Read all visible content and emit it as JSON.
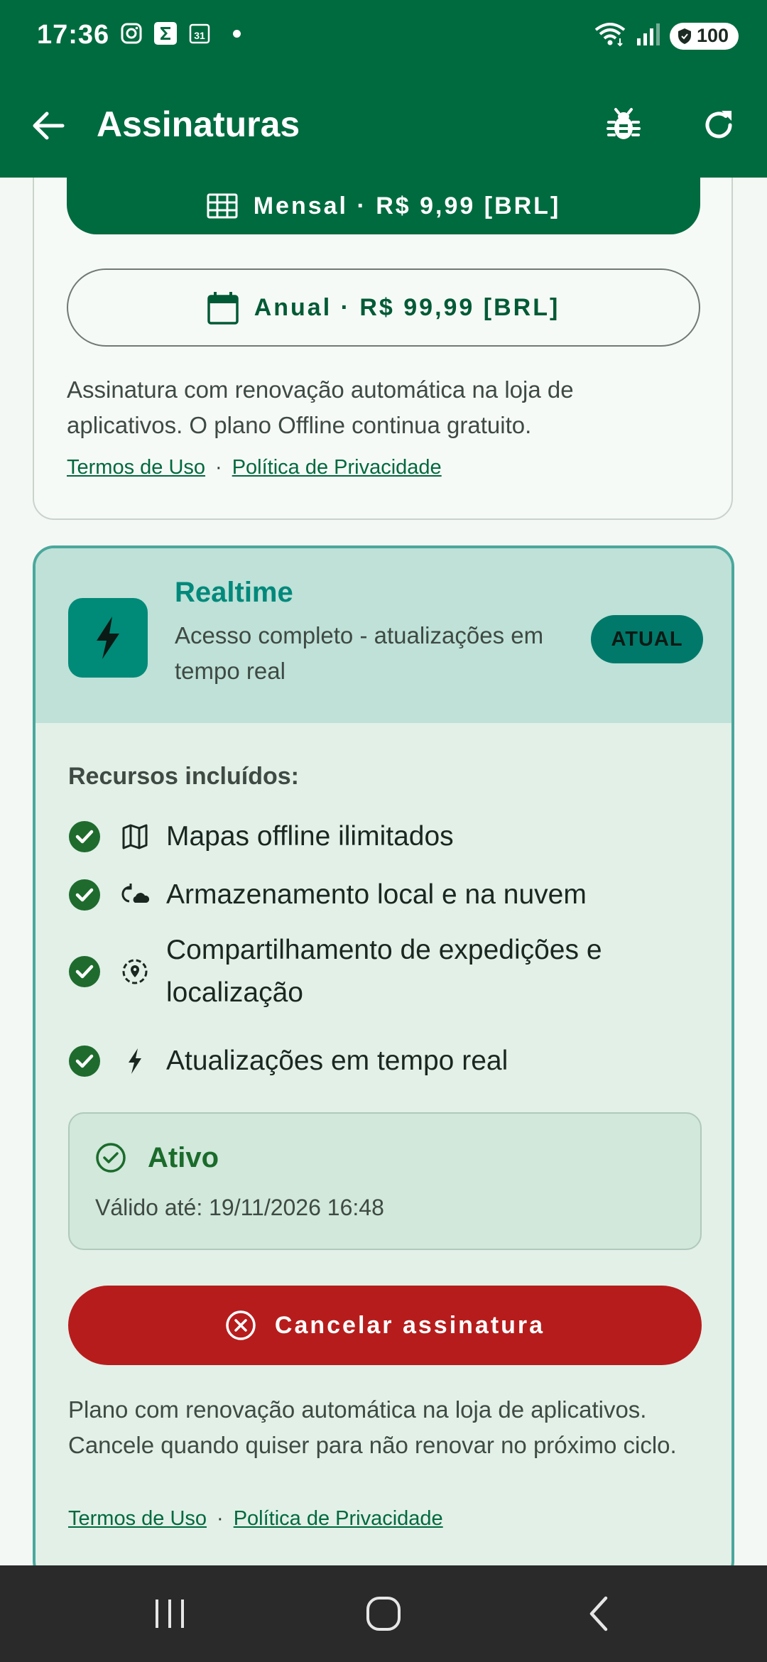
{
  "status_bar": {
    "time": "17:36",
    "icons": [
      "instagram-icon",
      "sigma-app-icon",
      "calendar-31-icon"
    ],
    "battery": "100"
  },
  "app_bar": {
    "title": "Assinaturas",
    "icons": [
      "back-arrow-icon",
      "bug-icon",
      "refresh-icon"
    ]
  },
  "top_card": {
    "monthly_button": "Mensal · R$ 9,99 [BRL]",
    "annual_button": "Anual · R$ 99,99 [BRL]",
    "description": "Assinatura com renovação automática na loja de aplicativos. O plano Offline continua gratuito.",
    "terms_link": "Termos de Uso",
    "separator": "·",
    "privacy_link": "Política de Privacidade"
  },
  "realtime_card": {
    "name": "Realtime",
    "subtitle": "Acesso completo - atualizações em tempo real",
    "badge": "ATUAL",
    "features_title": "Recursos incluídos:",
    "features": [
      {
        "icon": "map-icon",
        "text": "Mapas offline ilimitados"
      },
      {
        "icon": "cloud-sync-icon",
        "text": "Armazenamento local e na nuvem"
      },
      {
        "icon": "location-share-icon",
        "text": "Compartilhamento de expedições e localização"
      },
      {
        "icon": "bolt-icon",
        "text": "Atualizações em tempo real"
      }
    ],
    "status_title": "Ativo",
    "status_valid": "Válido até: 19/11/2026 16:48",
    "cancel_button": "Cancelar assinatura",
    "description": "Plano com renovação automática na loja de aplicativos. Cancele quando quiser para não renovar no próximo ciclo.",
    "terms_link": "Termos de Uso",
    "separator": "·",
    "privacy_link": "Política de Privacidade"
  },
  "colors": {
    "primary": "#006b3f",
    "accent_teal": "#00897b",
    "danger": "#b71c1c",
    "success": "#1b6b2b"
  }
}
